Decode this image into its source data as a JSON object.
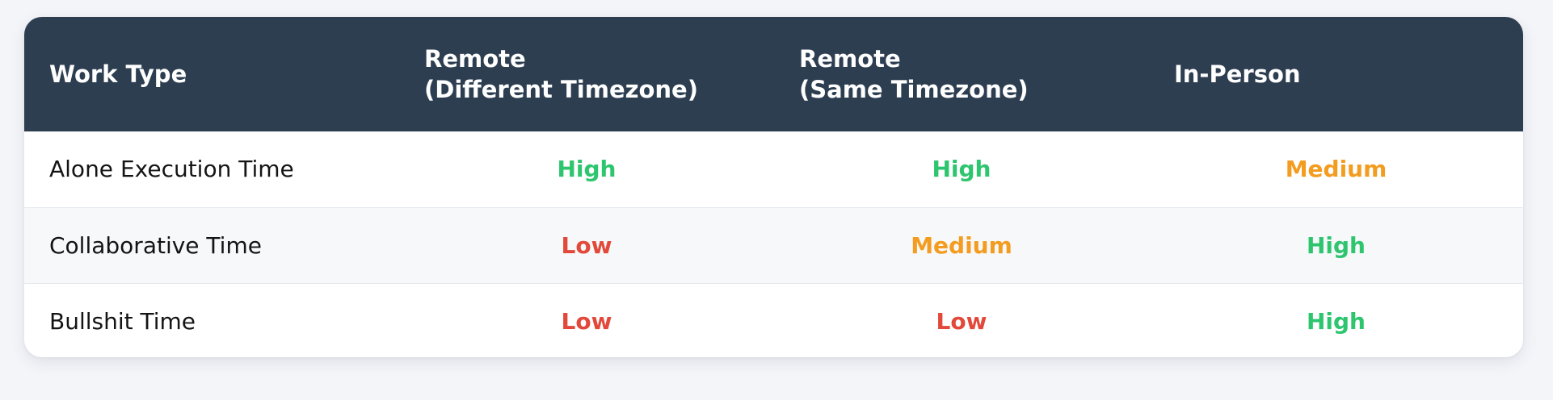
{
  "colors": {
    "page_background": "#f4f5f9",
    "header_background": "#2d3e51",
    "header_text": "#ffffff",
    "high": "#2ec56f",
    "medium": "#f39c1f",
    "low": "#e2493a"
  },
  "table": {
    "headers": [
      {
        "line1": "Work Type",
        "line2": ""
      },
      {
        "line1": "Remote",
        "line2": "(Different Timezone)"
      },
      {
        "line1": "Remote",
        "line2": "(Same Timezone)"
      },
      {
        "line1": "In-Person",
        "line2": ""
      }
    ],
    "rows": [
      {
        "label": "Alone Execution Time",
        "values": [
          "High",
          "High",
          "Medium"
        ]
      },
      {
        "label": "Collaborative Time",
        "values": [
          "Low",
          "Medium",
          "High"
        ]
      },
      {
        "label": "Bullshit Time",
        "values": [
          "Low",
          "Low",
          "High"
        ]
      }
    ]
  }
}
